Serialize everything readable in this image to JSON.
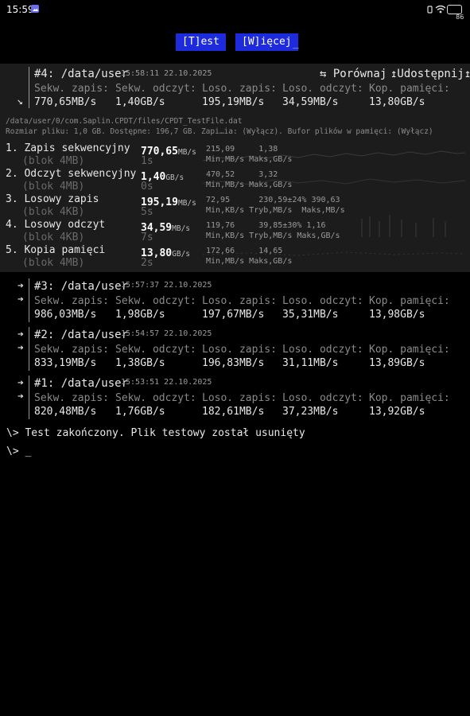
{
  "status_bar": {
    "time": "15:59",
    "battery": "86"
  },
  "toolbar": {
    "test_label": "[T]est",
    "more_label": "[W]ięcej",
    "cursor": "_"
  },
  "active_run": {
    "title": "#4: /data/user",
    "time": "15:58:11 22.10.2025",
    "compare_label": "⇆ Porównaj",
    "share_label": "↥Udostępnij↥",
    "headers": [
      "Sekw. zapis:",
      "Sekw. odczyt:",
      "Loso. zapis:",
      "Loso. odczyt:",
      "Kop. pamięci:"
    ],
    "values": [
      "770,65MB/s",
      "1,40GB/s",
      "195,19MB/s",
      "34,59MB/s",
      "13,80GB/s"
    ],
    "path": "/data/user/0/com.Saplin.CPDT/files/CPDT_TestFile.dat",
    "info": "Rozmiar pliku: 1,0 GB. Dostępne: 196,7 GB. Zapi…ia: (Wyłącz). Bufor plików w pamięci: (Wyłącz)",
    "tests": [
      {
        "name": "1. Zapis sekwencyjny",
        "block": "(blok 4MB)",
        "value": "770,65",
        "unit": "MB/s",
        "time": "1s",
        "stats_top": "215,09     1,38",
        "stats_bottom": "Min,MB/s Maks,GB/s"
      },
      {
        "name": "2. Odczyt sekwencyjny",
        "block": "(blok 4MB)",
        "value": "1,40",
        "unit": "GB/s",
        "time": "0s",
        "stats_top": "470,52     3,32",
        "stats_bottom": "Min,MB/s Maks,GB/s"
      },
      {
        "name": "3. Losowy zapis",
        "block": "(blok 4KB)",
        "value": "195,19",
        "unit": "MB/s",
        "time": "5s",
        "stats_top": "72,95      230,59±24% 390,63",
        "stats_bottom": "Min,KB/s Tryb,MB/s  Maks,MB/s"
      },
      {
        "name": "4. Losowy odczyt",
        "block": "(blok 4KB)",
        "value": "34,59",
        "unit": "MB/s",
        "time": "7s",
        "stats_top": "119,76     39,85±30% 1,16",
        "stats_bottom": "Min,KB/s Tryb,MB/s Maks,GB/s"
      },
      {
        "name": "5. Kopia pamięci",
        "block": "(blok 4MB)",
        "value": "13,80",
        "unit": "GB/s",
        "time": "2s",
        "stats_top": "172,66     14,65",
        "stats_bottom": "Min,MB/s Maks,GB/s"
      }
    ]
  },
  "history": [
    {
      "title": "#3: /data/user",
      "time": "15:57:37 22.10.2025",
      "values": [
        "986,03MB/s",
        "1,98GB/s",
        "197,67MB/s",
        "35,31MB/s",
        "13,98GB/s"
      ]
    },
    {
      "title": "#2: /data/user",
      "time": "15:54:57 22.10.2025",
      "values": [
        "833,19MB/s",
        "1,38GB/s",
        "196,83MB/s",
        "31,11MB/s",
        "13,89GB/s"
      ]
    },
    {
      "title": "#1: /data/user",
      "time": "15:53:51 22.10.2025",
      "values": [
        "820,48MB/s",
        "1,76GB/s",
        "182,61MB/s",
        "37,23MB/s",
        "13,92GB/s"
      ]
    }
  ],
  "console": {
    "line1": "\\> Test zakończony. Plik testowy został usunięty",
    "prompt": "\\> _"
  }
}
